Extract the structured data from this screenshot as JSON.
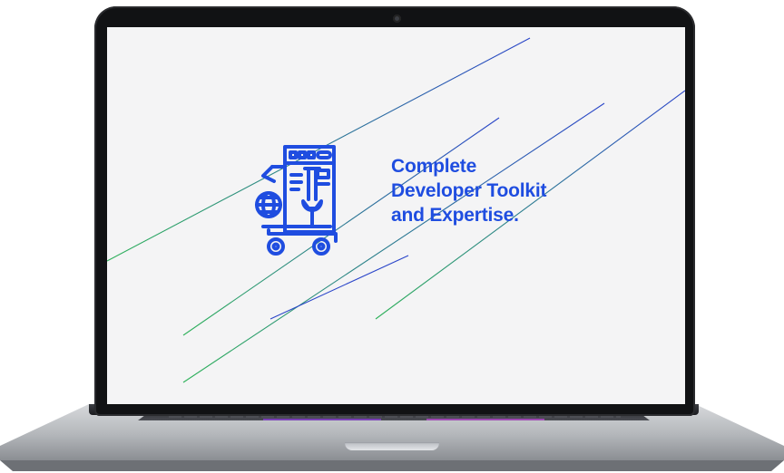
{
  "screen": {
    "headline": {
      "line1": "Complete",
      "line2": "Developer Toolkit",
      "line3": "and Expertise."
    },
    "logo_icon": "developer-toolkit-cart-icon"
  },
  "colors": {
    "brand_blue": "#1f4de0",
    "line_blue": "#2a45c9",
    "line_green": "#2fb25a",
    "screen_bg": "#f4f4f5",
    "bezel": "#111214",
    "body_silver": "#c8cacd"
  }
}
